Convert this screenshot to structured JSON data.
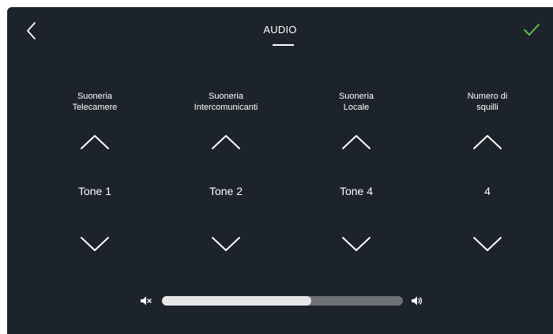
{
  "header": {
    "title": "AUDIO",
    "back_icon": "chevron-left-icon",
    "confirm_icon": "checkmark-icon",
    "confirm_color": "#5cc04a"
  },
  "columns": [
    {
      "label": "Suoneria\nTelecamere",
      "value": "Tone 1"
    },
    {
      "label": "Suoneria\nIntercomunicanti",
      "value": "Tone 2"
    },
    {
      "label": "Suoneria\nLocale",
      "value": "Tone 4"
    },
    {
      "label": "Numero di\nsquilli",
      "value": "4"
    }
  ],
  "volume": {
    "level": 0.62,
    "min_icon": "speaker-mute-icon",
    "max_icon": "speaker-volume-icon"
  },
  "colors": {
    "background": "#1d232a",
    "text": "#ffffff",
    "slider_track": "#6e7277",
    "slider_fill": "#e6e6e6"
  }
}
